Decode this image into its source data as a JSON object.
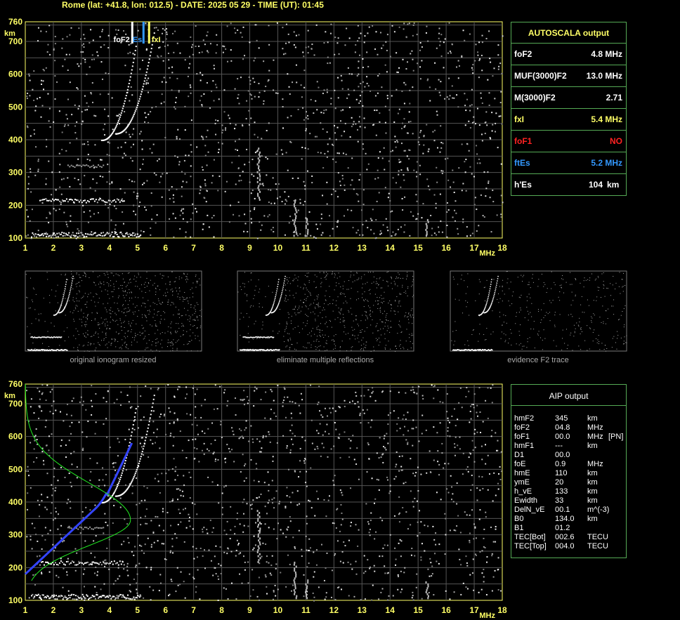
{
  "header": "Rome (lat: +41.8, lon: 012.5) - DATE: 2025 05 29 - TIME (UT): 01:45",
  "axes": {
    "y_unit": "km",
    "x_unit": "MHz",
    "y_ticks": [
      "760",
      "700",
      "600",
      "500",
      "400",
      "300",
      "200",
      "100"
    ],
    "x_ticks": [
      "1",
      "2",
      "3",
      "4",
      "5",
      "6",
      "7",
      "8",
      "9",
      "10",
      "11",
      "12",
      "13",
      "14",
      "15",
      "16",
      "17",
      "18"
    ]
  },
  "markers": {
    "foF2_label": "foF2",
    "ftEs_label": "Es",
    "fxI_label": "fxI"
  },
  "autoscala": {
    "title": "AUTOSCALA output",
    "rows": [
      {
        "key": "foF2",
        "value": "4.8 MHz",
        "unit": "",
        "color": "#ffffff"
      },
      {
        "key": "MUF(3000)F2",
        "value": "13.0 MHz",
        "unit": "",
        "color": "#ffffff"
      },
      {
        "key": "M(3000)F2",
        "value": "2.71",
        "unit": "",
        "color": "#ffffff"
      },
      {
        "key": "fxI",
        "value": "5.4 MHz",
        "unit": "",
        "color": "#ffff66"
      },
      {
        "key": "foF1",
        "value": "NO",
        "unit": "",
        "color": "#ff2222"
      },
      {
        "key": "ftEs",
        "value": "5.2 MHz",
        "unit": "",
        "color": "#3399ff"
      },
      {
        "key": "h'Es",
        "value": "104",
        "unit": "km",
        "color": "#ffffff"
      }
    ]
  },
  "captions": {
    "thumb1": "original ionogram resized",
    "thumb2": "eliminate multiple reflections",
    "thumb3": "evidence F2 trace"
  },
  "aip": {
    "title": "AIP output",
    "rows": [
      {
        "k": "hmF2",
        "v": "345",
        "u": "km",
        "x": ""
      },
      {
        "k": "foF2",
        "v": "04.8",
        "u": "MHz",
        "x": ""
      },
      {
        "k": "foF1",
        "v": "00.0",
        "u": "MHz",
        "x": "[PN]"
      },
      {
        "k": "hmF1",
        "v": "---",
        "u": "km",
        "x": ""
      },
      {
        "k": "D1",
        "v": "00.0",
        "u": "",
        "x": ""
      },
      {
        "k": "foE",
        "v": "0.9",
        "u": "MHz",
        "x": ""
      },
      {
        "k": "hmE",
        "v": "110",
        "u": "km",
        "x": ""
      },
      {
        "k": "ymE",
        "v": "20",
        "u": "km",
        "x": ""
      },
      {
        "k": "h_vE",
        "v": "133",
        "u": "km",
        "x": ""
      },
      {
        "k": "Ewidth",
        "v": "33",
        "u": "km",
        "x": ""
      },
      {
        "k": "DelN_vE",
        "v": "00.1",
        "u": "m^(-3)",
        "x": ""
      },
      {
        "k": "B0",
        "v": "134.0",
        "u": "km",
        "x": ""
      },
      {
        "k": "B1",
        "v": "01.2",
        "u": "",
        "x": ""
      },
      {
        "k": "TEC[Bot]",
        "v": "002.6",
        "u": "TECU",
        "x": ""
      },
      {
        "k": "TEC[Top]",
        "v": "004.0",
        "u": "TECU",
        "x": ""
      }
    ]
  },
  "chart_data": {
    "type": "scatter",
    "xlim": [
      1,
      18
    ],
    "ylim": [
      100,
      760
    ],
    "xlabel": "MHz",
    "ylabel": "km",
    "grid": true,
    "series": [
      {
        "values_x": [
          1.2,
          1.5,
          2.0,
          2.5,
          3.0,
          3.5,
          4.0,
          4.5,
          5.0
        ],
        "values_y": [
          110,
          110,
          110,
          110,
          110,
          110,
          110,
          110,
          110
        ]
      },
      {
        "values_x": [
          1.5,
          2.0,
          2.5,
          3.0,
          3.5,
          4.0,
          4.5
        ],
        "values_y": [
          215,
          215,
          215,
          215,
          215,
          215,
          215
        ]
      },
      {
        "values_x": [
          3.8,
          4.0,
          4.2,
          4.4,
          4.6,
          4.8,
          5.0
        ],
        "values_y": [
          400,
          420,
          450,
          480,
          520,
          570,
          650
        ]
      },
      {
        "values_x": [
          4.4,
          4.6,
          4.8,
          5.0,
          5.2,
          5.4,
          5.6
        ],
        "values_y": [
          420,
          440,
          470,
          500,
          540,
          600,
          700
        ]
      }
    ]
  }
}
